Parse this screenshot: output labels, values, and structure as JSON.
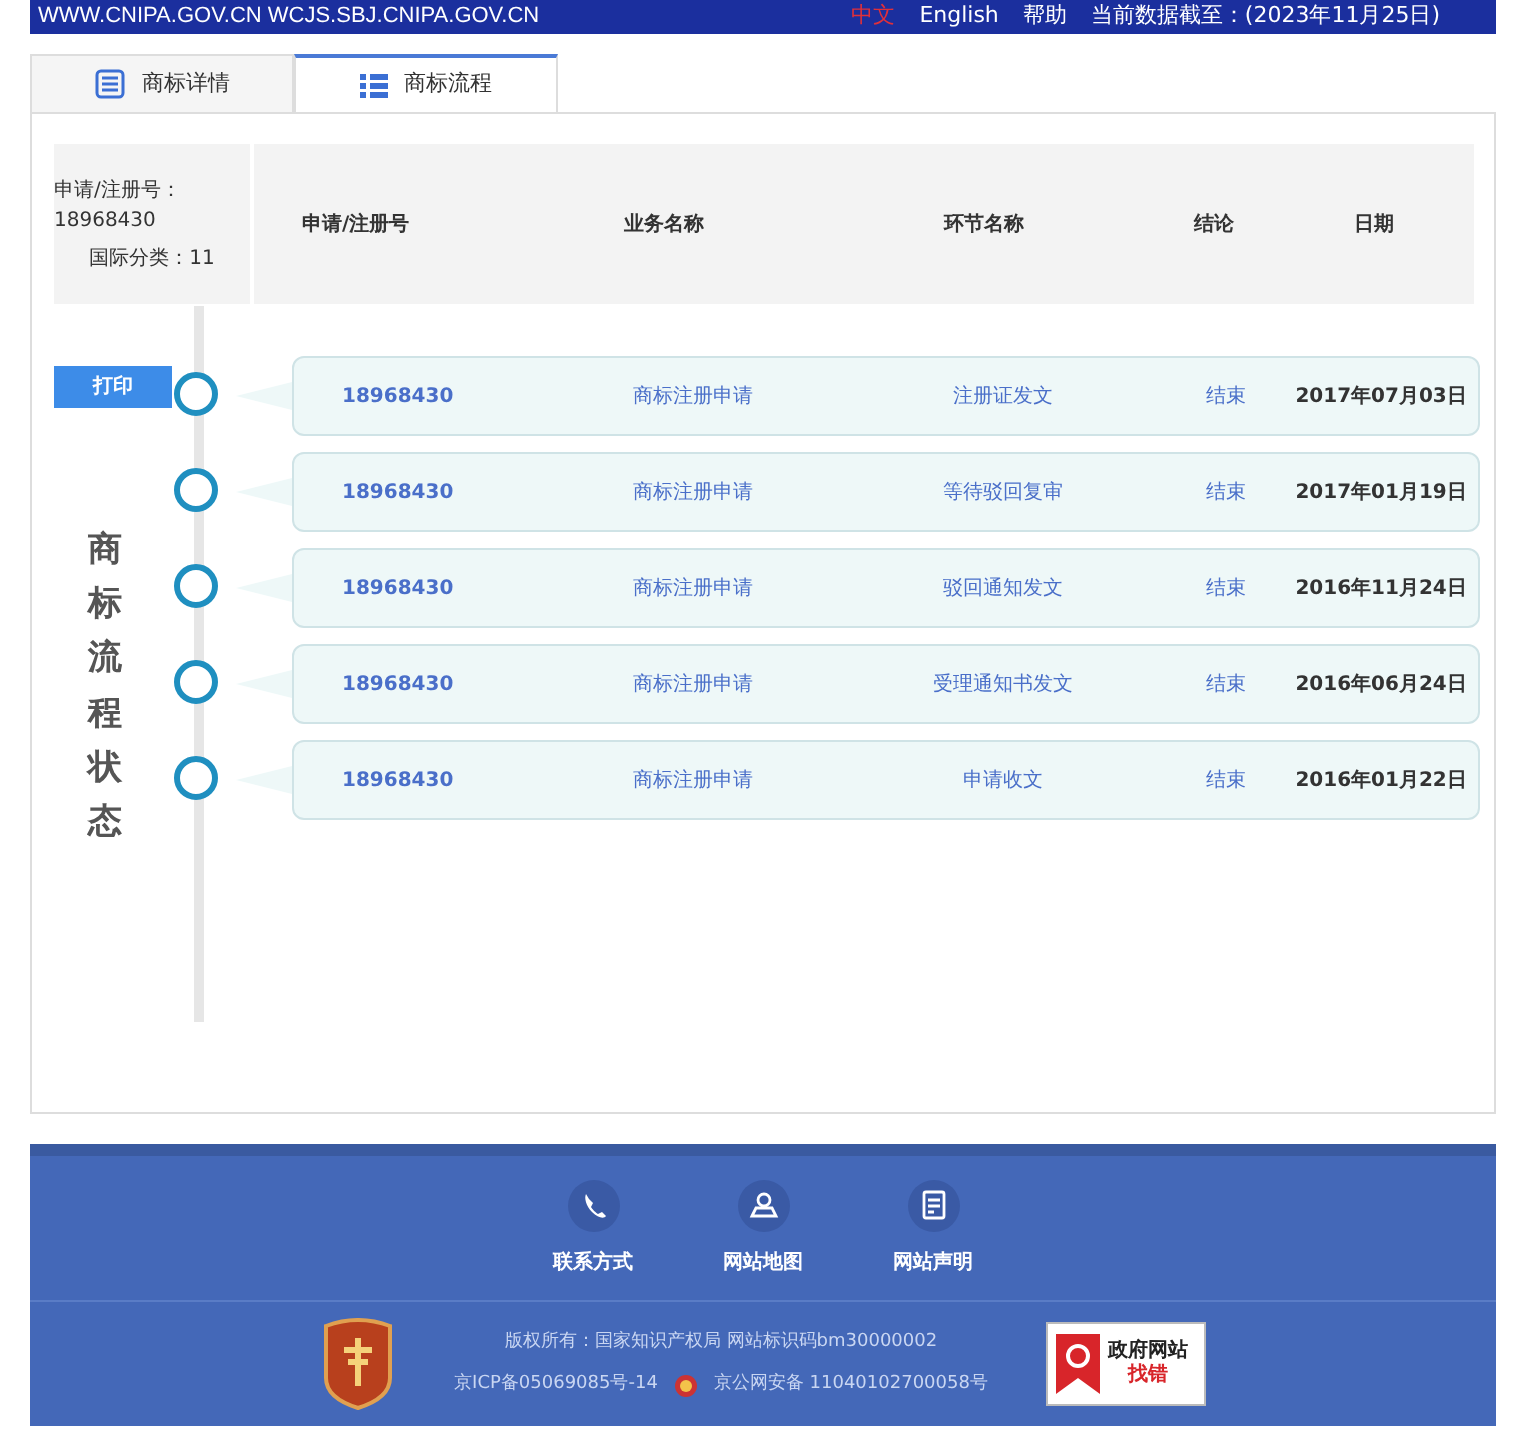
{
  "top_bar": {
    "site": "WWW.CNIPA.GOV.CN WCJS.SBJ.CNIPA.GOV.CN",
    "links": [
      {
        "label": "中文",
        "selected": true
      },
      {
        "label": "English",
        "selected": false
      },
      {
        "label": "帮助",
        "selected": false
      }
    ],
    "data_date": "当前数据截至：(2023年11月25日)"
  },
  "tabs": [
    {
      "label": "商标详情",
      "kind": "details",
      "selected": false
    },
    {
      "label": "商标流程",
      "kind": "flow",
      "selected": true
    }
  ],
  "summary": {
    "reg_no": "申请/注册号：18968430",
    "class": "国际分类：11"
  },
  "table": {
    "columns": [
      "申请/注册号",
      "业务名称",
      "环节名称",
      "结论",
      "日期"
    ],
    "rows": [
      {
        "cells": [
          "18968430",
          "商标注册申请",
          "注册证发文",
          "结束",
          "2017年07月03日"
        ]
      },
      {
        "cells": [
          "18968430",
          "商标注册申请",
          "等待驳回复审",
          "结束",
          "2017年01月19日"
        ]
      },
      {
        "cells": [
          "18968430",
          "商标注册申请",
          "驳回通知发文",
          "结束",
          "2016年11月24日"
        ]
      },
      {
        "cells": [
          "18968430",
          "商标注册申请",
          "受理通知书发文",
          "结束",
          "2016年06月24日"
        ]
      },
      {
        "cells": [
          "18968430",
          "商标注册申请",
          "申请收文",
          "结束",
          "2016年01月22日"
        ]
      }
    ]
  },
  "print_button": "打印",
  "side_label": "商标流程状态",
  "footer": {
    "links": [
      {
        "label": "联系方式",
        "kind": "phone"
      },
      {
        "label": "网站地图",
        "kind": "map"
      },
      {
        "label": "网站声明",
        "kind": "doc"
      }
    ],
    "copyright": "版权所有：国家知识产权局 网站标识码bm30000002",
    "icp": "京ICP备05069085号-14",
    "police": "京公网安备 11040102700058号",
    "report_badge": [
      "政府网站",
      "找错"
    ]
  }
}
